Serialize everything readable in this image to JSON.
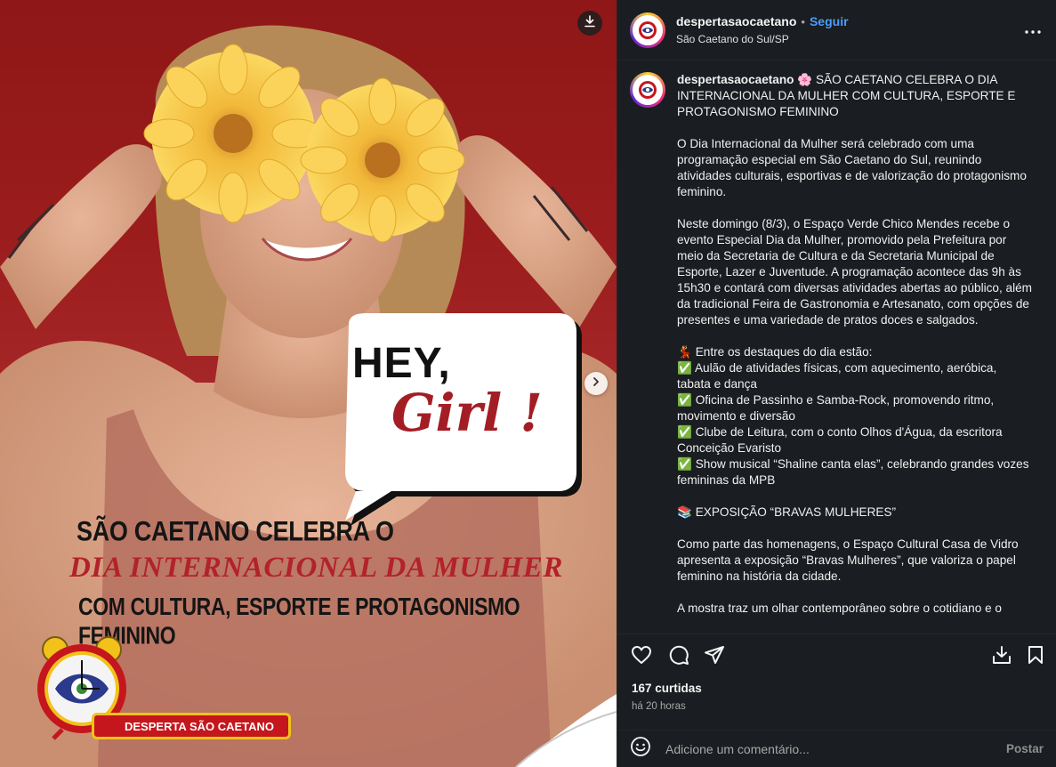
{
  "post": {
    "download_icon": "download-icon",
    "next_icon": "chevron-right-icon",
    "art": {
      "bubble_line1": "HEY,",
      "bubble_line2": "Girl !",
      "heading_line1": "SÃO CAETANO CELEBRA O",
      "heading_line2": "DIA INTERNACIONAL DA MULHER",
      "heading_line3": "COM CULTURA, ESPORTE E PROTAGONISMO FEMININO",
      "logo_text": "DESPERTA SÃO CAETANO"
    },
    "colors": {
      "background_red": "#9b1c1c",
      "heading_red": "#b3222a",
      "flower_yellow": "#f5c531"
    }
  },
  "header": {
    "username": "despertasaocaetano",
    "separator": "•",
    "follow_label": "Seguir",
    "location": "São Caetano do Sul/SP",
    "more_icon": "more-horizontal-icon"
  },
  "caption": {
    "username": "despertasaocaetano",
    "body": " 🌸 SÃO CAETANO CELEBRA O DIA INTERNACIONAL DA MULHER COM CULTURA, ESPORTE E PROTAGONISMO FEMININO\n\nO Dia Internacional da Mulher será celebrado com uma programação especial em São Caetano do Sul, reunindo atividades culturais, esportivas e de valorização do protagonismo feminino.\n\nNeste domingo (8/3), o Espaço Verde Chico Mendes recebe o evento Especial Dia da Mulher, promovido pela Prefeitura por meio da Secretaria de Cultura e da Secretaria Municipal de Esporte, Lazer e Juventude. A programação acontece das 9h às 15h30 e contará com diversas atividades abertas ao público, além da tradicional Feira de Gastronomia e Artesanato, com opções de presentes e uma variedade de pratos doces e salgados.\n\n💃 Entre os destaques do dia estão:\n✅ Aulão de atividades físicas, com aquecimento, aeróbica, tabata e dança\n✅ Oficina de Passinho e Samba-Rock, promovendo ritmo, movimento e diversão\n✅ Clube de Leitura, com o conto Olhos d'Água, da escritora Conceição Evaristo\n✅ Show musical “Shaline canta elas”, celebrando grandes vozes femininas da MPB\n\n📚 EXPOSIÇÃO “BRAVAS MULHERES”\n\nComo parte das homenagens, o Espaço Cultural Casa de Vidro apresenta a exposição “Bravas Mulheres”, que valoriza o papel feminino na história da cidade.\n\nA mostra traz um olhar contemporâneo sobre o cotidiano e o"
  },
  "actions": {
    "like_icon": "heart-icon",
    "comment_icon": "comment-icon",
    "share_icon": "share-icon",
    "save_collection_icon": "download-icon",
    "bookmark_icon": "bookmark-icon"
  },
  "stats": {
    "likes": "167 curtidas",
    "time": "há 20 horas"
  },
  "comment": {
    "emoji_icon": "smiley-icon",
    "placeholder": "Adicione um comentário...",
    "post_label": "Postar"
  }
}
